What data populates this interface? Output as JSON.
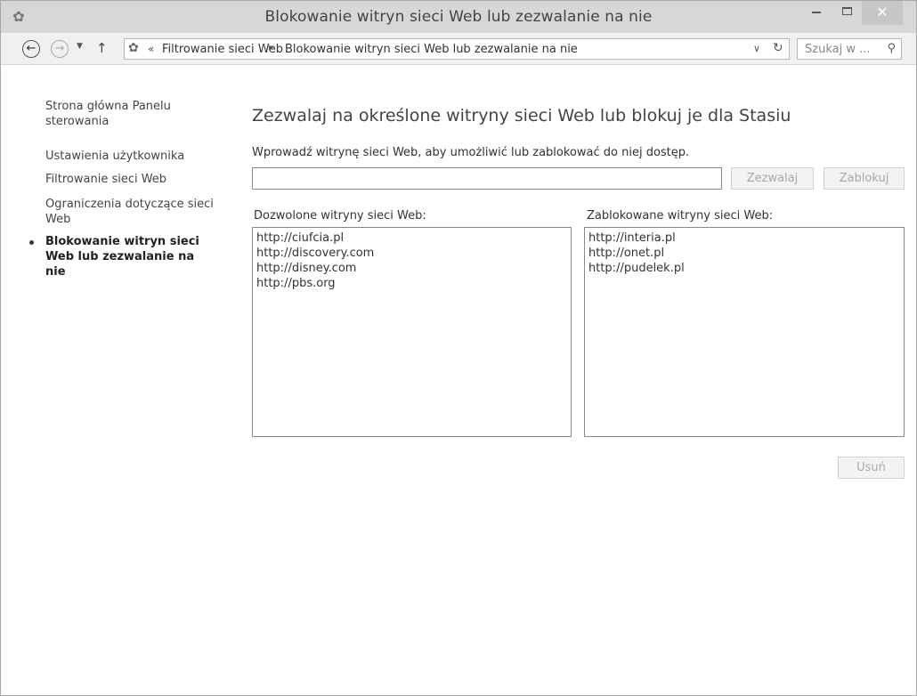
{
  "window": {
    "title": "Blokowanie witryn sieci Web lub zezwalanie na nie",
    "minimize": "–",
    "close": "✕"
  },
  "navbar": {
    "back": "←",
    "forward": "→",
    "recent": "▼",
    "up": "↑",
    "address": {
      "separator": "«",
      "crumbs": [
        "Filtrowanie sieci Web",
        "Blokowanie witryn sieci Web lub zezwalanie na nie"
      ],
      "arrow": "▸",
      "dropdown": "∨",
      "refresh": "↻"
    },
    "search": {
      "placeholder": "Szukaj w ...",
      "icon": "⚲"
    }
  },
  "sidebar": {
    "items": [
      {
        "label": "Strona główna Panelu sterowania"
      },
      {
        "label": "Ustawienia użytkownika"
      },
      {
        "label": "Filtrowanie sieci Web"
      },
      {
        "label": "Ograniczenia dotyczące sieci Web"
      },
      {
        "label": "Blokowanie witryn sieci Web lub zezwalanie na nie",
        "active": true
      }
    ]
  },
  "main": {
    "title": "Zezwalaj na określone witryny sieci Web lub blokuj je dla Stasiu",
    "instruction": "Wprowadź witrynę sieci Web, aby umożliwić lub zablokować do niej dostęp.",
    "site_input_value": "",
    "allow_button": "Zezwalaj",
    "block_button": "Zablokuj",
    "allowed_label": "Dozwolone witryny sieci Web:",
    "blocked_label": "Zablokowane witryny sieci Web:",
    "allowed_sites": [
      "http://ciufcia.pl",
      "http://discovery.com",
      "http://disney.com",
      "http://pbs.org"
    ],
    "blocked_sites": [
      "http://interia.pl",
      "http://onet.pl",
      "http://pudelek.pl"
    ],
    "remove_button": "Usuń"
  }
}
